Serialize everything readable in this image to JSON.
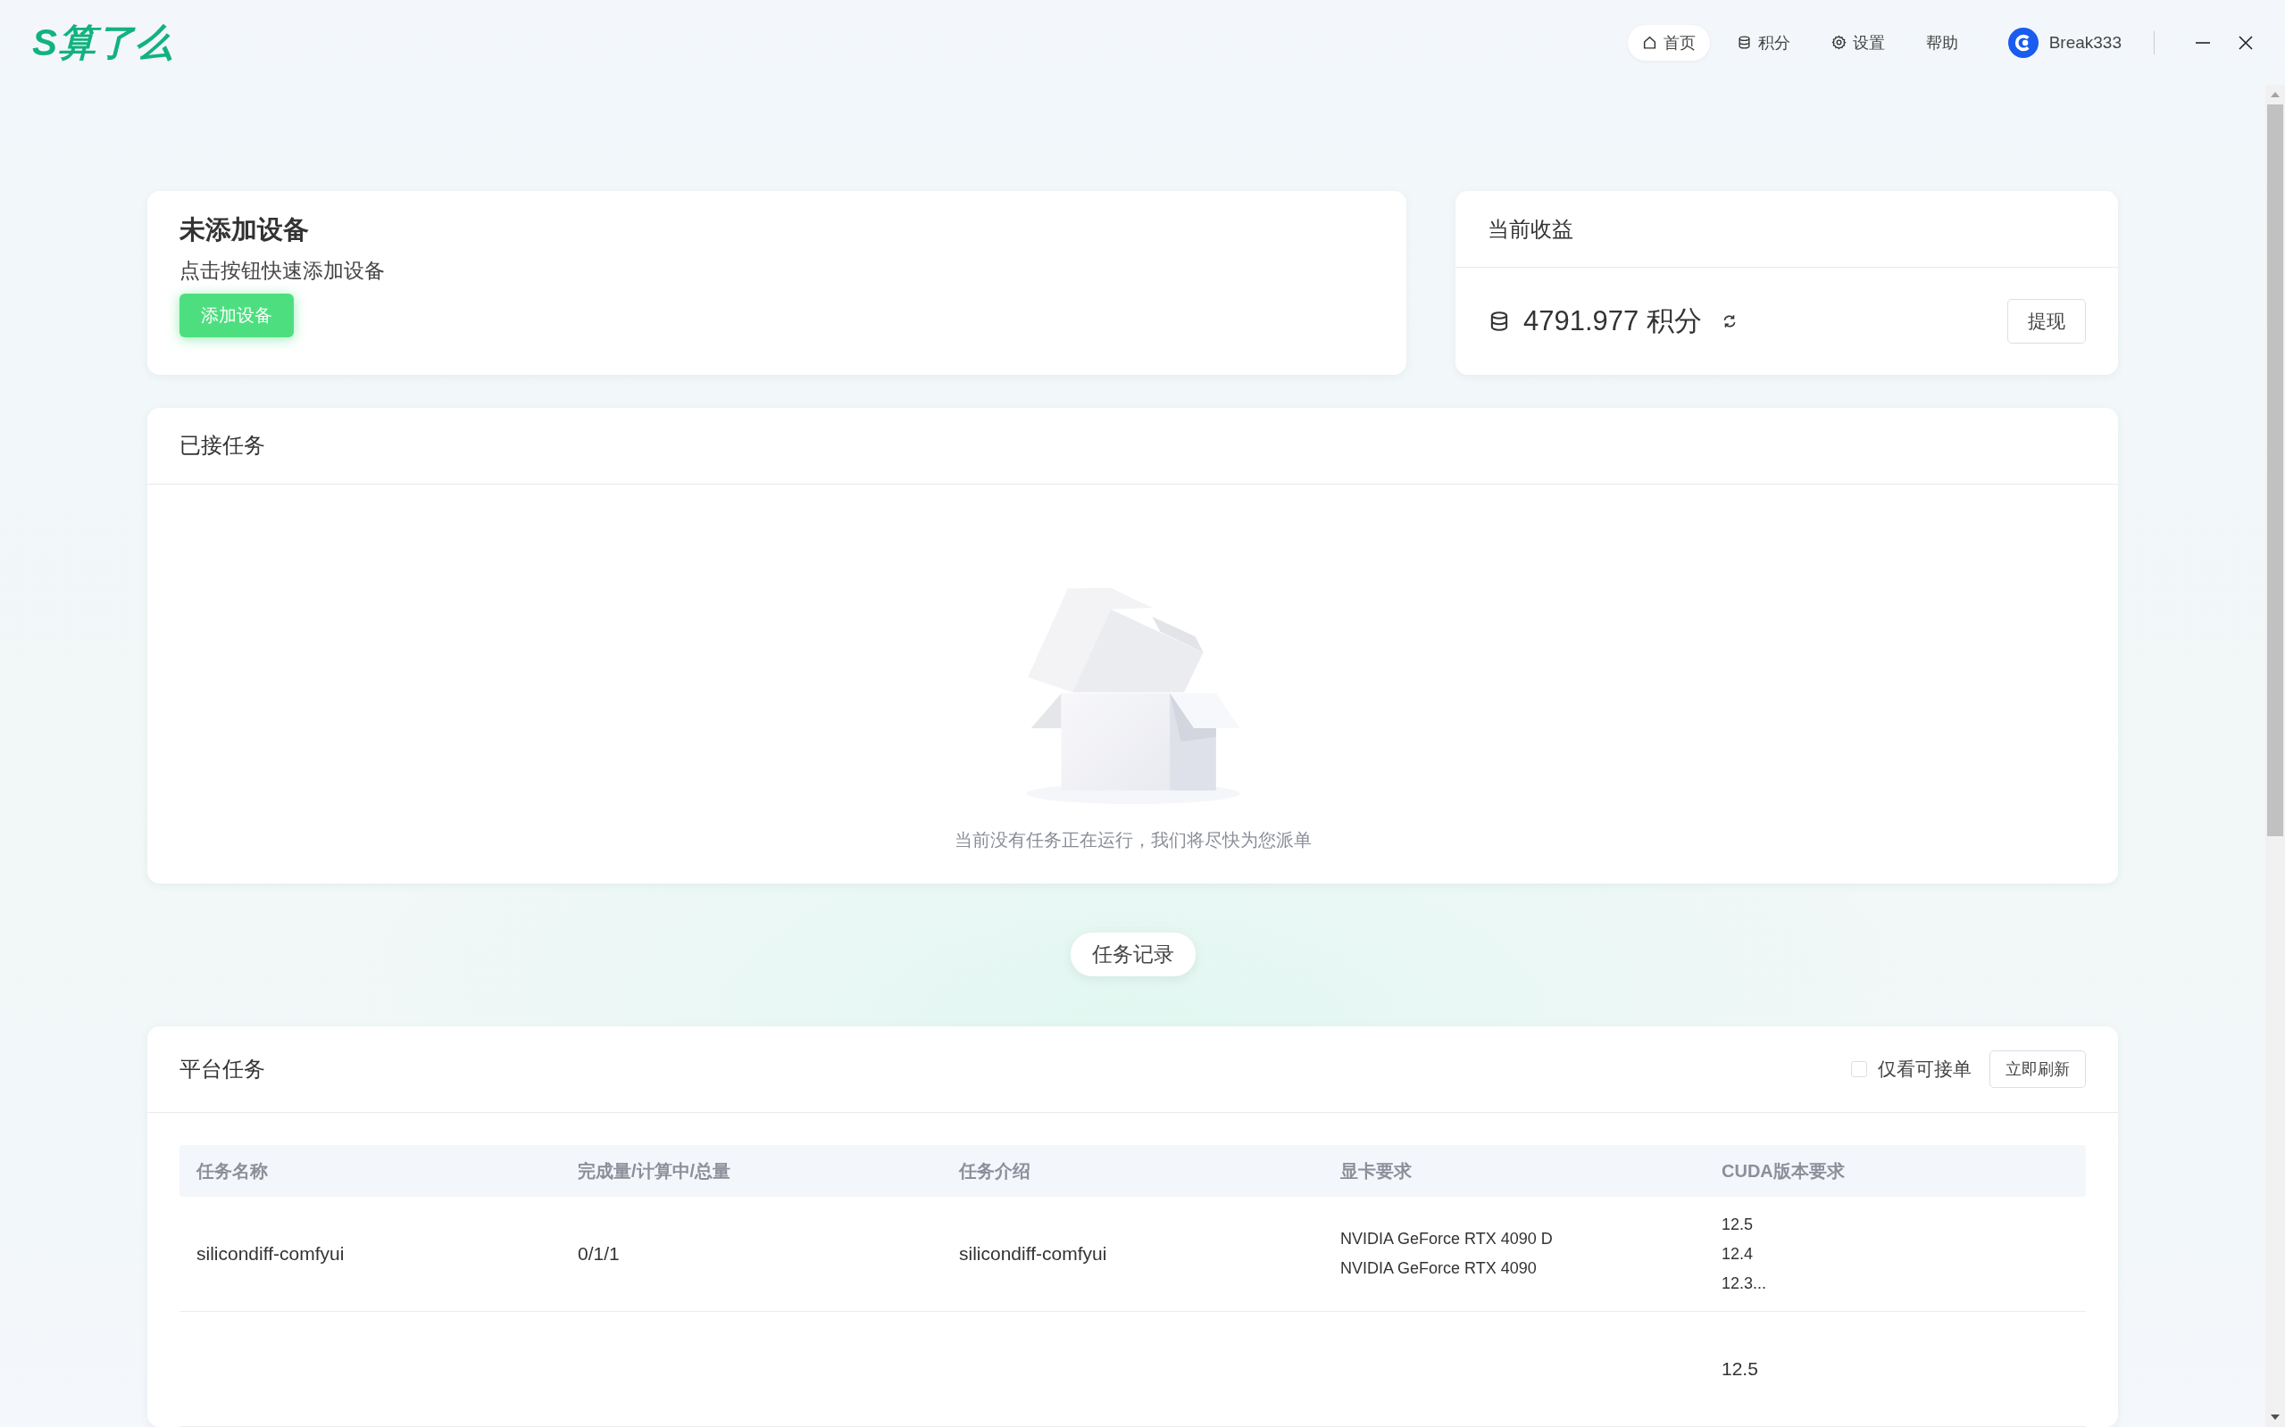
{
  "logo": "S算了么",
  "nav": [
    {
      "label": "首页",
      "selected": true,
      "kind": "home"
    },
    {
      "label": "积分",
      "selected": false,
      "kind": "coins"
    },
    {
      "label": "设置",
      "selected": false,
      "kind": "gear"
    },
    {
      "label": "帮助",
      "selected": false,
      "kind": "plain"
    }
  ],
  "user": {
    "name": "Break333"
  },
  "device_card": {
    "title": "未添加设备",
    "subtitle": "点击按钮快速添加设备",
    "button": "添加设备"
  },
  "earnings": {
    "title": "当前收益",
    "amount": "4791.977 积分",
    "button": "提现"
  },
  "accepted_tasks": {
    "title": "已接任务",
    "empty_text": "当前没有任务正在运行，我们将尽快为您派单"
  },
  "history_button": "任务记录",
  "platform_tasks": {
    "title": "平台任务",
    "filter": {
      "label": "仅看可接单",
      "checked": false
    },
    "refresh_button": "立即刷新",
    "table": {
      "columns": [
        "任务名称",
        "完成量/计算中/总量",
        "任务介绍",
        "显卡要求",
        "CUDA版本要求"
      ],
      "rows": [
        {
          "cells": [
            [
              "silicondiff-comfyui"
            ],
            [
              "0/1/1"
            ],
            [
              "silicondiff-comfyui"
            ],
            [
              "NVIDIA GeForce RTX 4090 D",
              "NVIDIA GeForce RTX 4090"
            ],
            [
              "12.5",
              "12.4",
              "12.3..."
            ]
          ]
        },
        {
          "cells": [
            null,
            null,
            null,
            null,
            [
              "12.5"
            ]
          ]
        }
      ]
    }
  }
}
